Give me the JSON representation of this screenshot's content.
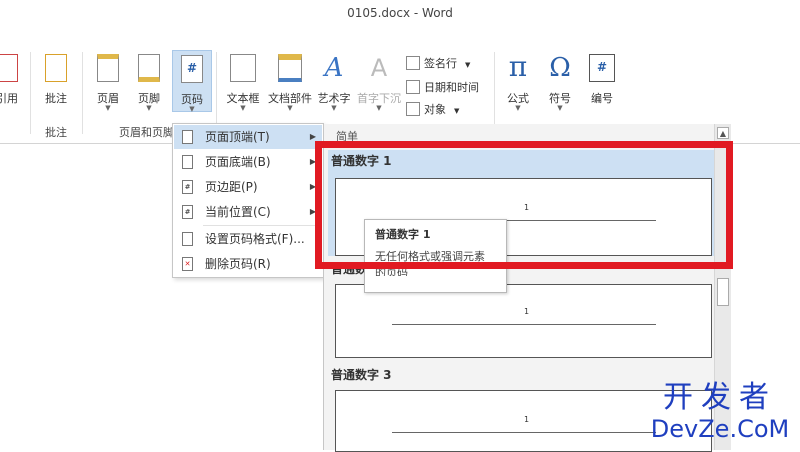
{
  "window": {
    "title": "0105.docx - Word"
  },
  "ribbon": {
    "buttons": [
      {
        "label": "引用"
      },
      {
        "label": "批注"
      },
      {
        "label": "页眉"
      },
      {
        "label": "页脚"
      },
      {
        "label": "页码"
      },
      {
        "label": "文本框"
      },
      {
        "label": "文档部件"
      },
      {
        "label": "艺术字"
      },
      {
        "label": "首字下沉"
      },
      {
        "label": "公式"
      },
      {
        "label": "符号"
      },
      {
        "label": "编号"
      }
    ],
    "small_buttons": [
      {
        "label": "签名行"
      },
      {
        "label": "日期和时间"
      },
      {
        "label": "对象"
      }
    ],
    "groups": [
      {
        "label": "批注"
      },
      {
        "label": "页眉和页脚"
      }
    ],
    "symbols": {
      "pi": "π",
      "omega": "Ω",
      "hash": "#",
      "artA": "A"
    }
  },
  "menu": {
    "items": [
      {
        "label": "页面顶端(T)"
      },
      {
        "label": "页面底端(B)"
      },
      {
        "label": "页边距(P)"
      },
      {
        "label": "当前位置(C)"
      },
      {
        "label": "设置页码格式(F)..."
      },
      {
        "label": "删除页码(R)"
      }
    ]
  },
  "gallery": {
    "header": "简单",
    "items": [
      {
        "title": "普通数字 1",
        "number": "1"
      },
      {
        "title": "普通数字 2",
        "number": "1"
      },
      {
        "title": "普通数字 3",
        "number": "1"
      }
    ]
  },
  "tooltip": {
    "title": "普通数字 1",
    "line1": "无任何格式或强调元素",
    "line2": "的页码"
  },
  "watermark": {
    "line1": "开发者",
    "line2": "DevZe.CoM"
  },
  "colors": {
    "highlight": "#cde0f3",
    "red_box": "#e11a22",
    "watermark": "#1f3fbf"
  }
}
